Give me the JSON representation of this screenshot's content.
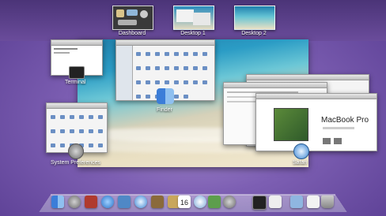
{
  "spaces": [
    {
      "label": "Dashboard"
    },
    {
      "label": "Desktop 1"
    },
    {
      "label": "Desktop 2"
    }
  ],
  "windows": {
    "terminal_label": "Terminal",
    "finder_label": "Finder",
    "sysprefs_label": "System Preferences",
    "safari_label": "Safari",
    "safari_heading": "MacBook Pro"
  },
  "dock": {
    "icons": [
      "finder-icon",
      "launchpad-icon",
      "photo-booth-icon",
      "app-store-icon",
      "preview-icon",
      "safari-icon",
      "address-book-icon",
      "itunes-icon",
      "mail-icon",
      "calendar-icon",
      "photos-icon",
      "system-preferences-icon",
      "terminal-icon",
      "textedit-icon",
      "downloads-icon",
      "documents-icon",
      "trash-icon"
    ],
    "calendar_day": "16"
  },
  "colors": {
    "accent": "#7d5fb3",
    "sea": "#2b9cc5",
    "sand": "#e9dfc2"
  }
}
